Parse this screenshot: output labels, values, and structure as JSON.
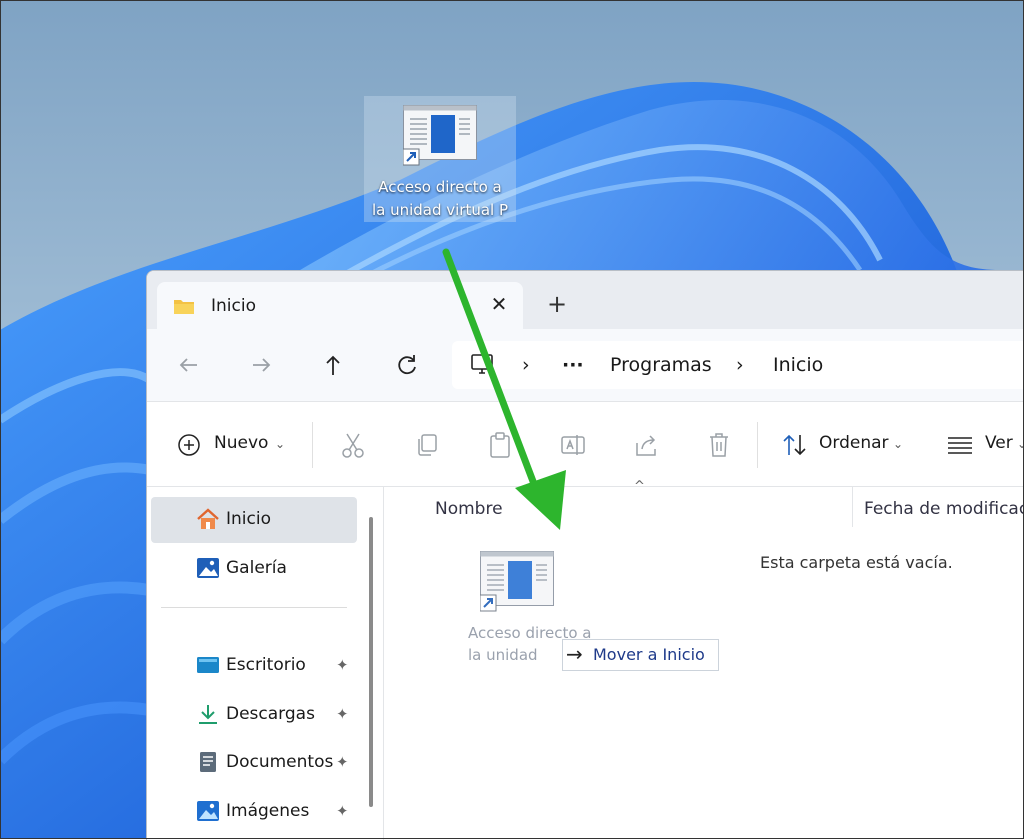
{
  "desktop": {
    "shortcut_label": "Acceso directo a\nla unidad virtual P"
  },
  "explorer": {
    "tab": {
      "title": "Inicio",
      "close_icon": "close-icon",
      "new_tab": "+"
    },
    "nav": {
      "breadcrumb_more": "···",
      "breadcrumb": [
        "Programas",
        "Inicio"
      ],
      "separator": "›"
    },
    "toolbar": {
      "new_label": "Nuevo",
      "sort_label": "Ordenar",
      "view_label": "Ver"
    },
    "sidebar": {
      "items": [
        {
          "label": "Inicio",
          "icon": "home-icon"
        },
        {
          "label": "Galería",
          "icon": "gallery-icon"
        },
        {
          "label": "Escritorio",
          "icon": "desktop-folder-icon",
          "pinned": true
        },
        {
          "label": "Descargas",
          "icon": "download-icon",
          "pinned": true
        },
        {
          "label": "Documentos",
          "icon": "documents-icon",
          "pinned": true
        },
        {
          "label": "Imágenes",
          "icon": "pictures-icon",
          "pinned": true
        }
      ],
      "pin_glyph": "📌"
    },
    "content": {
      "col_name": "Nombre",
      "col_date": "Fecha de modificaci",
      "empty_message": "Esta carpeta está vacía.",
      "ghost_label": "Acceso directo a\nla unidad",
      "drag_tooltip": "Mover a Inicio"
    }
  },
  "colors": {
    "accent": "#1a73e8",
    "drag_arrow": "#2db52d",
    "wallpaper": "#1f6fe0"
  }
}
